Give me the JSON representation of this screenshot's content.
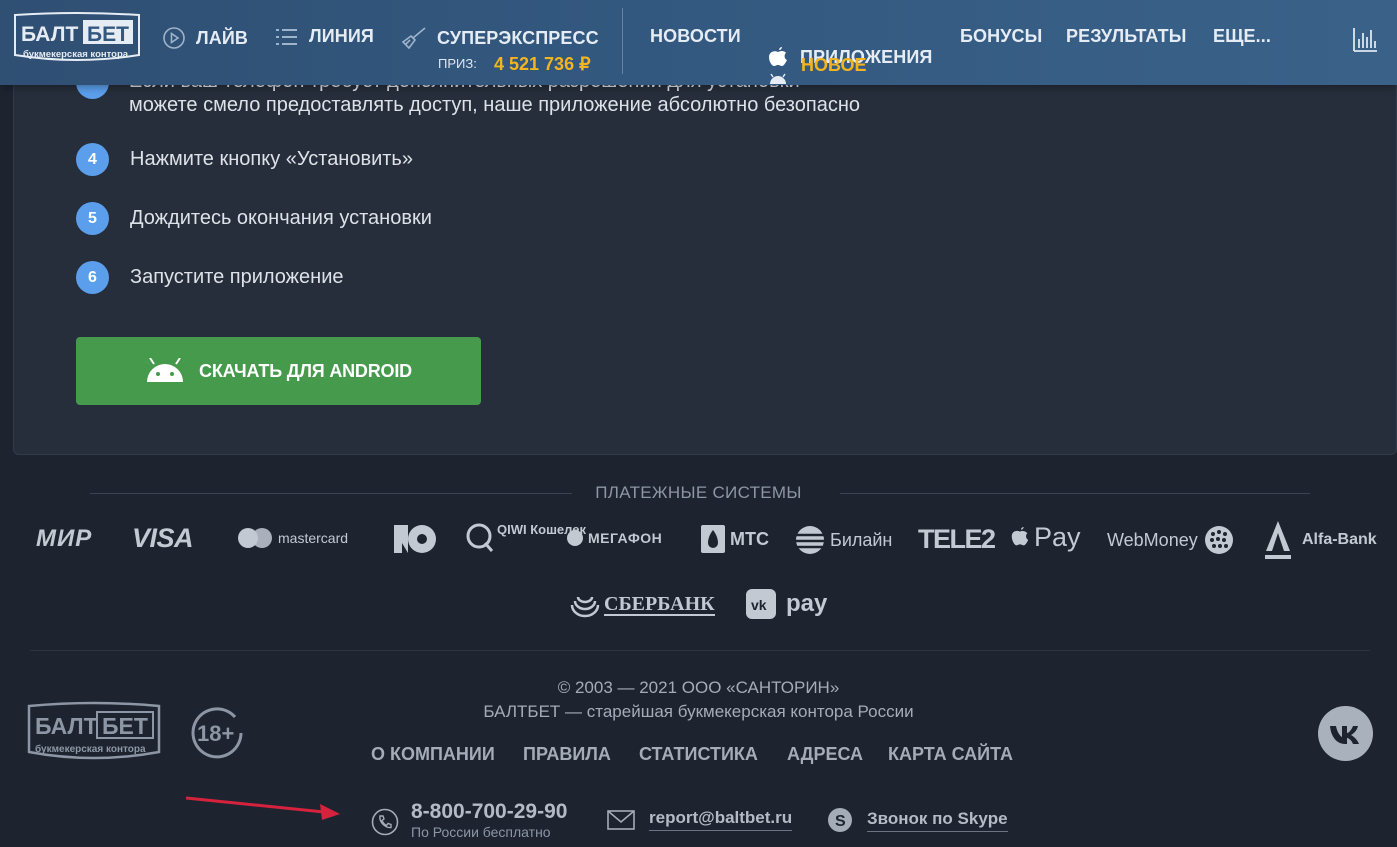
{
  "header": {
    "logo_top": "БАЛТ",
    "logo_top_box": "БЕТ",
    "logo_sub": "букмекерская контора",
    "nav": {
      "live": "ЛАЙВ",
      "line": "ЛИНИЯ",
      "superexpress": "СУПЕРЭКСПРЕСС",
      "news": "НОВОСТИ",
      "apps": "ПРИЛОЖЕНИЯ",
      "bonuses": "БОНУСЫ",
      "results": "РЕЗУЛЬТАТЫ",
      "more": "ЕЩЕ..."
    },
    "prize_label": "ПРИЗ:",
    "prize_value": "4 521 736 ₽",
    "new_badge": "НОВОЕ"
  },
  "instructions": {
    "partial_line_1": "Если ваш телефон требует дополнительных разрешений для установки",
    "partial_line_2": "можете смело предоставлять доступ, наше приложение абсолютно безопасно",
    "steps": [
      {
        "num": "4",
        "text": "Нажмите кнопку «Установить»"
      },
      {
        "num": "5",
        "text": "Дождитесь окончания установки"
      },
      {
        "num": "6",
        "text": "Запустите приложение"
      }
    ],
    "download_button": "СКАЧАТЬ ДЛЯ ANDROID"
  },
  "payments": {
    "title": "ПЛАТЕЖНЫЕ СИСТЕМЫ",
    "row1": [
      "МИР",
      "VISA",
      "mastercard",
      "ЮMoney",
      "QIWI Кошелек",
      "МЕГАФОН",
      "МТС",
      "Билайн",
      "TELE2",
      "Pay",
      "WebMoney",
      "Alfa-Bank"
    ],
    "row2": [
      "СБЕРБАНК",
      "pay"
    ]
  },
  "footer": {
    "copyright": "© 2003 — 2021 ООО «САНТОРИН»",
    "tagline": "БАЛТБЕТ — старейшая букмекерская контора России",
    "age": "18+",
    "links": {
      "about": "О КОМПАНИИ",
      "rules": "ПРАВИЛА",
      "stats": "СТАТИСТИКА",
      "addresses": "АДРЕСА",
      "sitemap": "КАРТА САЙТА"
    },
    "phone": "8-800-700-29-90",
    "phone_note": "По России бесплатно",
    "email": "report@baltbet.ru",
    "skype": "Звонок по Skype"
  },
  "colors": {
    "header": "#33587f",
    "accent_yellow": "#f3b51f",
    "step_badge": "#5b9fec",
    "android_button": "#469a4c",
    "arrow": "#d6223d"
  }
}
